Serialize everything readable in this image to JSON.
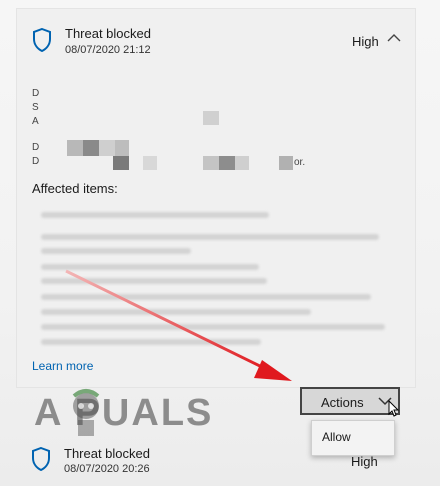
{
  "threats": [
    {
      "title": "Threat blocked",
      "date": "08/07/2020 21:12",
      "severity": "High"
    },
    {
      "title": "Threat blocked",
      "date": "08/07/2020 20:26",
      "severity": "High"
    }
  ],
  "details": {
    "line_prefixes": [
      "D",
      "S",
      "A",
      "D",
      "D"
    ],
    "suffix": "or."
  },
  "affected_label": "Affected items:",
  "learn_more": "Learn more",
  "actions_label": "Actions",
  "menu": {
    "allow_label": "Allow"
  },
  "watermark_text": "A  PUALS",
  "colors": {
    "accent": "#0063b1",
    "arrow": "#e0191e",
    "shield": "#0063b1"
  },
  "icons": {
    "shield": "shield-icon",
    "chevron_up": "chevron-up-icon",
    "chevron_down": "chevron-down-icon",
    "cursor": "mouse-cursor-icon"
  }
}
